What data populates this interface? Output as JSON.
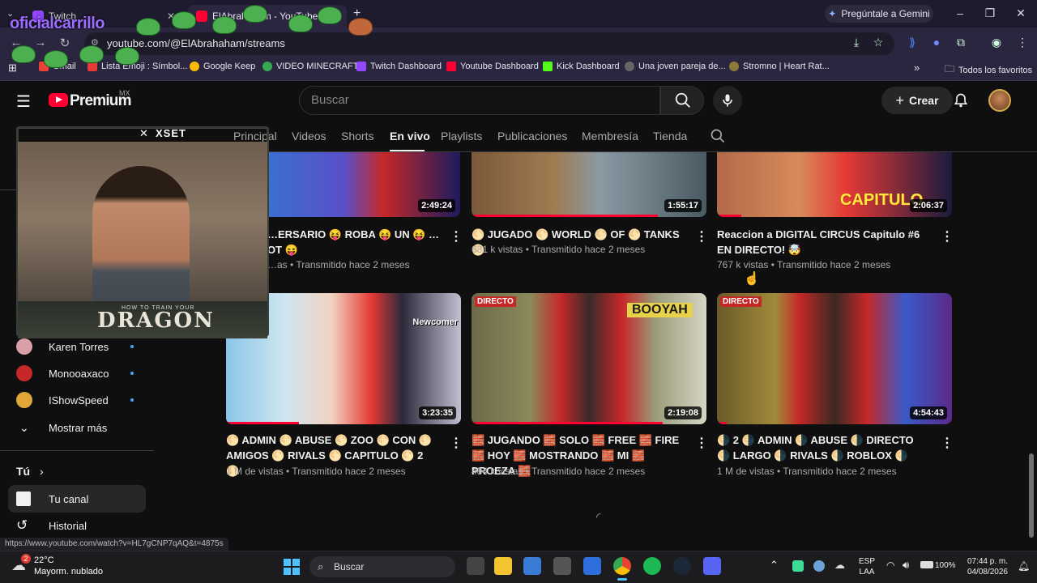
{
  "browser": {
    "tabs": [
      {
        "label": "Twitch",
        "active": false
      },
      {
        "label": "ElAbrahaham - YouTube",
        "active": true
      }
    ],
    "new_tab": "+",
    "gemini": "Pregúntale a Gemini",
    "url": "youtube.com/@ElAbrahaham/streams",
    "bookmarks": [
      "Gmail",
      "Lista Emoji : Símbol...",
      "Google Keep",
      "VIDEO MINECRAFT",
      "Twitch Dashboard",
      "Youtube Dashboard",
      "Kick Dashboard",
      "Una joven pareja de...",
      "Stromno | Heart Rat..."
    ],
    "more_bookmarks": "»",
    "all_favorites": "Todos los favoritos",
    "status_url": "https://www.youtube.com/watch?v=HL7gCNP7qAQ&t=4875s",
    "colors": {
      "tab_bar": "#1f1b2e",
      "toolbar": "#2b2640"
    }
  },
  "overlay": {
    "streamer_name": "oficialcarrillo",
    "sponsor": "XSET",
    "movie_subtitle": "HOW TO TRAIN YOUR",
    "movie_title": "DRAGON"
  },
  "youtube": {
    "brand": "Premium",
    "region": "MX",
    "search_placeholder": "Buscar",
    "create": "Crear",
    "channel_tabs": [
      "Principal",
      "Videos",
      "Shorts",
      "En vivo",
      "Playlists",
      "Publicaciones",
      "Membresía",
      "Tienda"
    ],
    "active_tab": "En vivo",
    "sidebar": {
      "subscriptions": [
        {
          "name": "Karen Torres"
        },
        {
          "name": "Monooaxaco"
        },
        {
          "name": "IShowSpeed"
        }
      ],
      "show_more": "Mostrar más",
      "you_section": "Tú",
      "your_channel": "Tu canal",
      "history": "Historial"
    },
    "videos_row1": [
      {
        "title": "…ERSARIO 😝 ROBA 😝 UN 😝 …OT 😝",
        "meta": "…as • Transmitido hace 2 meses",
        "duration": "2:49:24"
      },
      {
        "title": "🌕 JUGADO 🌕 WORLD 🌕 OF 🌕 TANKS 🌕",
        "meta": "681 k vistas • Transmitido hace 2 meses",
        "duration": "1:55:17"
      },
      {
        "title": "Reaccion a DIGITAL CIRCUS Capitulo #6 EN DIRECTO! 🤯",
        "meta": "767 k vistas • Transmitido hace 2 meses",
        "duration": "2:06:37",
        "thumb_text": "CAPITULO"
      }
    ],
    "videos_row2": [
      {
        "title": "🌕 ADMIN 🌕 ABUSE 🌕 ZOO 🌕 CON 🌕 AMIGOS 🌕 RIVALS 🌕 CAPITULO 🌕 2 🌕",
        "meta": "1 M de vistas • Transmitido hace 2 meses",
        "duration": "3:23:35",
        "thumb_label": "Newcomer"
      },
      {
        "title": "🧱 JUGANDO 🧱 SOLO 🧱 FREE 🧱 FIRE 🧱 HOY 🧱 MOSTRANDO 🧱 MI 🧱 PROEZA 🧱",
        "meta": "484 k vistas • Transmitido hace 2 meses",
        "duration": "2:19:08",
        "thumb_label": "DIRECTO",
        "thumb_label2": "BOOYAH"
      },
      {
        "title": "🌗 2 🌗 ADMIN 🌗 ABUSE 🌗 DIRECTO 🌗 LARGO 🌗 RIVALS 🌗 ROBLOX 🌗",
        "meta": "1 M de vistas • Transmitido hace 2 meses",
        "duration": "4:54:43",
        "thumb_label": "DIRECTO"
      }
    ]
  },
  "taskbar": {
    "weather_temp": "22°C",
    "weather_desc": "Mayorm. nublado",
    "weather_badge": "2",
    "search": "Buscar",
    "lang": "ESP",
    "lang2": "LAA",
    "battery": "100%",
    "time": "07:44 p. m.",
    "date": "04/08/2026"
  }
}
